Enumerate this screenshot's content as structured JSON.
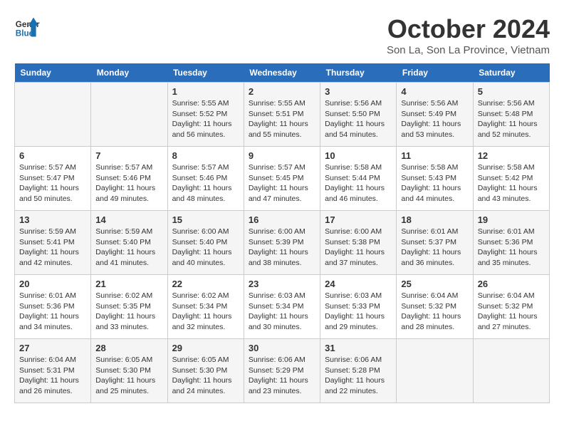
{
  "header": {
    "logo_line1": "General",
    "logo_line2": "Blue",
    "month": "October 2024",
    "location": "Son La, Son La Province, Vietnam"
  },
  "weekdays": [
    "Sunday",
    "Monday",
    "Tuesday",
    "Wednesday",
    "Thursday",
    "Friday",
    "Saturday"
  ],
  "weeks": [
    [
      {
        "day": "",
        "info": ""
      },
      {
        "day": "",
        "info": ""
      },
      {
        "day": "1",
        "info": "Sunrise: 5:55 AM\nSunset: 5:52 PM\nDaylight: 11 hours and 56 minutes."
      },
      {
        "day": "2",
        "info": "Sunrise: 5:55 AM\nSunset: 5:51 PM\nDaylight: 11 hours and 55 minutes."
      },
      {
        "day": "3",
        "info": "Sunrise: 5:56 AM\nSunset: 5:50 PM\nDaylight: 11 hours and 54 minutes."
      },
      {
        "day": "4",
        "info": "Sunrise: 5:56 AM\nSunset: 5:49 PM\nDaylight: 11 hours and 53 minutes."
      },
      {
        "day": "5",
        "info": "Sunrise: 5:56 AM\nSunset: 5:48 PM\nDaylight: 11 hours and 52 minutes."
      }
    ],
    [
      {
        "day": "6",
        "info": "Sunrise: 5:57 AM\nSunset: 5:47 PM\nDaylight: 11 hours and 50 minutes."
      },
      {
        "day": "7",
        "info": "Sunrise: 5:57 AM\nSunset: 5:46 PM\nDaylight: 11 hours and 49 minutes."
      },
      {
        "day": "8",
        "info": "Sunrise: 5:57 AM\nSunset: 5:46 PM\nDaylight: 11 hours and 48 minutes."
      },
      {
        "day": "9",
        "info": "Sunrise: 5:57 AM\nSunset: 5:45 PM\nDaylight: 11 hours and 47 minutes."
      },
      {
        "day": "10",
        "info": "Sunrise: 5:58 AM\nSunset: 5:44 PM\nDaylight: 11 hours and 46 minutes."
      },
      {
        "day": "11",
        "info": "Sunrise: 5:58 AM\nSunset: 5:43 PM\nDaylight: 11 hours and 44 minutes."
      },
      {
        "day": "12",
        "info": "Sunrise: 5:58 AM\nSunset: 5:42 PM\nDaylight: 11 hours and 43 minutes."
      }
    ],
    [
      {
        "day": "13",
        "info": "Sunrise: 5:59 AM\nSunset: 5:41 PM\nDaylight: 11 hours and 42 minutes."
      },
      {
        "day": "14",
        "info": "Sunrise: 5:59 AM\nSunset: 5:40 PM\nDaylight: 11 hours and 41 minutes."
      },
      {
        "day": "15",
        "info": "Sunrise: 6:00 AM\nSunset: 5:40 PM\nDaylight: 11 hours and 40 minutes."
      },
      {
        "day": "16",
        "info": "Sunrise: 6:00 AM\nSunset: 5:39 PM\nDaylight: 11 hours and 38 minutes."
      },
      {
        "day": "17",
        "info": "Sunrise: 6:00 AM\nSunset: 5:38 PM\nDaylight: 11 hours and 37 minutes."
      },
      {
        "day": "18",
        "info": "Sunrise: 6:01 AM\nSunset: 5:37 PM\nDaylight: 11 hours and 36 minutes."
      },
      {
        "day": "19",
        "info": "Sunrise: 6:01 AM\nSunset: 5:36 PM\nDaylight: 11 hours and 35 minutes."
      }
    ],
    [
      {
        "day": "20",
        "info": "Sunrise: 6:01 AM\nSunset: 5:36 PM\nDaylight: 11 hours and 34 minutes."
      },
      {
        "day": "21",
        "info": "Sunrise: 6:02 AM\nSunset: 5:35 PM\nDaylight: 11 hours and 33 minutes."
      },
      {
        "day": "22",
        "info": "Sunrise: 6:02 AM\nSunset: 5:34 PM\nDaylight: 11 hours and 32 minutes."
      },
      {
        "day": "23",
        "info": "Sunrise: 6:03 AM\nSunset: 5:34 PM\nDaylight: 11 hours and 30 minutes."
      },
      {
        "day": "24",
        "info": "Sunrise: 6:03 AM\nSunset: 5:33 PM\nDaylight: 11 hours and 29 minutes."
      },
      {
        "day": "25",
        "info": "Sunrise: 6:04 AM\nSunset: 5:32 PM\nDaylight: 11 hours and 28 minutes."
      },
      {
        "day": "26",
        "info": "Sunrise: 6:04 AM\nSunset: 5:32 PM\nDaylight: 11 hours and 27 minutes."
      }
    ],
    [
      {
        "day": "27",
        "info": "Sunrise: 6:04 AM\nSunset: 5:31 PM\nDaylight: 11 hours and 26 minutes."
      },
      {
        "day": "28",
        "info": "Sunrise: 6:05 AM\nSunset: 5:30 PM\nDaylight: 11 hours and 25 minutes."
      },
      {
        "day": "29",
        "info": "Sunrise: 6:05 AM\nSunset: 5:30 PM\nDaylight: 11 hours and 24 minutes."
      },
      {
        "day": "30",
        "info": "Sunrise: 6:06 AM\nSunset: 5:29 PM\nDaylight: 11 hours and 23 minutes."
      },
      {
        "day": "31",
        "info": "Sunrise: 6:06 AM\nSunset: 5:28 PM\nDaylight: 11 hours and 22 minutes."
      },
      {
        "day": "",
        "info": ""
      },
      {
        "day": "",
        "info": ""
      }
    ]
  ]
}
